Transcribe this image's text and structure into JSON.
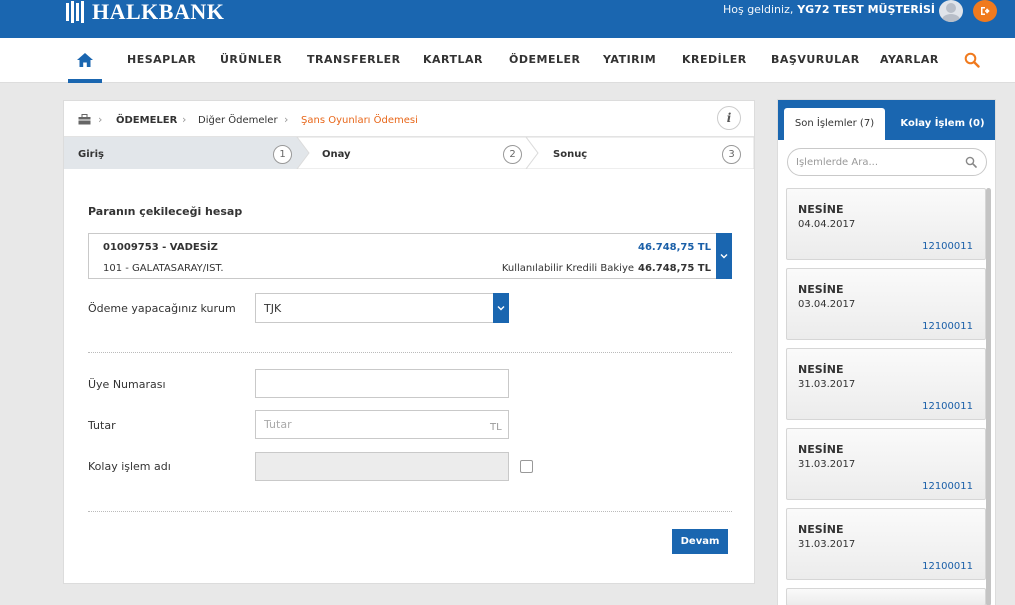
{
  "header": {
    "logo_text": "HALKBANK",
    "welcome_prefix": "Hoş geldiniz,",
    "user_name": "YG72 TEST MÜŞTERİSİ",
    "logout_icon": "logout-icon"
  },
  "nav": {
    "items": [
      "HESAPLAR",
      "ÜRÜNLER",
      "TRANSFERLER",
      "KARTLAR",
      "ÖDEMELER",
      "YATIRIM",
      "KREDİLER",
      "BAŞVURULAR",
      "AYARLAR"
    ]
  },
  "breadcrumb": {
    "items": [
      "ÖDEMELER",
      "Diğer Ödemeler",
      "Şans Oyunları Ödemesi"
    ]
  },
  "steps": [
    {
      "label": "Giriş",
      "num": "1"
    },
    {
      "label": "Onay",
      "num": "2"
    },
    {
      "label": "Sonuç",
      "num": "3"
    }
  ],
  "form": {
    "account_section_title": "Paranın çekileceği hesap",
    "account": {
      "name": "01009753 - VADESİZ",
      "branch": "101 - GALATASARAY/IST.",
      "balance": "46.748,75 TL",
      "available_label": "Kullanılabilir Kredili Bakiye",
      "available_value": "46.748,75 TL"
    },
    "institution_label": "Ödeme yapacağınız kurum",
    "institution_value": "TJK",
    "member_label": "Üye Numarası",
    "member_value": "",
    "amount_label": "Tutar",
    "amount_placeholder": "Tutar",
    "amount_suffix": "TL",
    "easy_label": "Kolay işlem adı",
    "submit_label": "Devam"
  },
  "sidebar": {
    "tab_recent": "Son İşlemler (7)",
    "tab_easy": "Kolay İşlem (0)",
    "search_placeholder": "İşlemlerde Ara...",
    "items": [
      {
        "title": "NESİNE",
        "date": "04.04.2017",
        "number": "12100011"
      },
      {
        "title": "NESİNE",
        "date": "03.04.2017",
        "number": "12100011"
      },
      {
        "title": "NESİNE",
        "date": "31.03.2017",
        "number": "12100011"
      },
      {
        "title": "NESİNE",
        "date": "31.03.2017",
        "number": "12100011"
      },
      {
        "title": "NESİNE",
        "date": "31.03.2017",
        "number": "12100011"
      }
    ]
  },
  "colors": {
    "brand_blue": "#1a66b0",
    "accent_orange": "#f07a1e"
  }
}
